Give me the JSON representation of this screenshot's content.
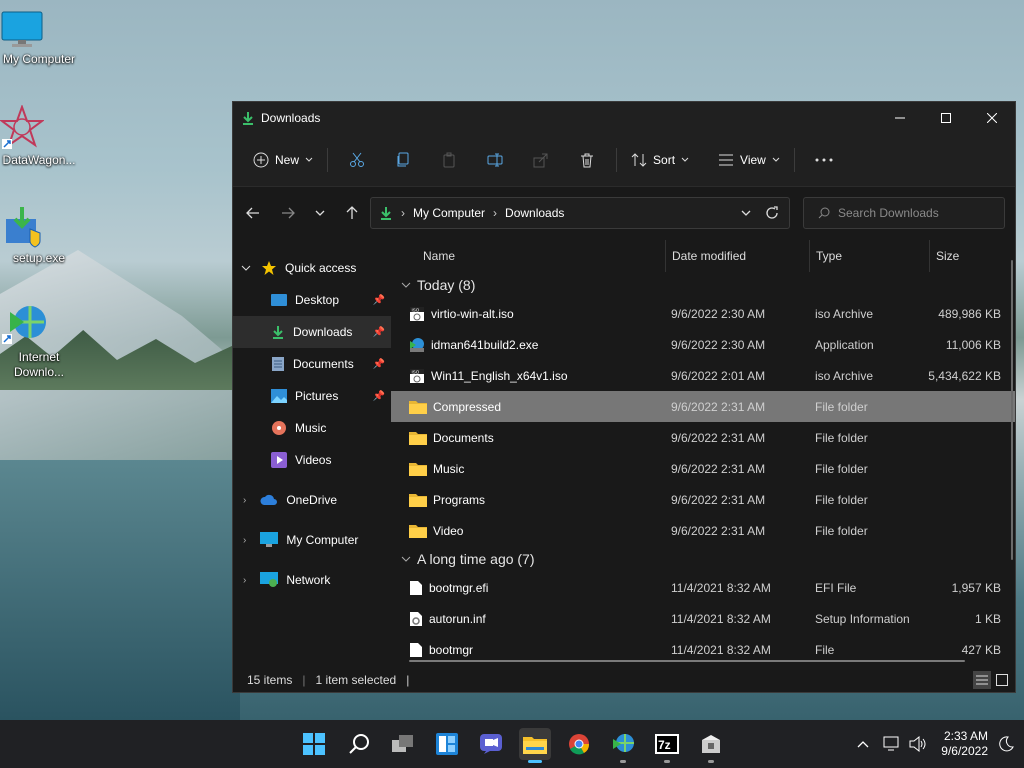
{
  "desktop": {
    "icons": [
      {
        "label": "My Computer"
      },
      {
        "label": "DataWagon..."
      },
      {
        "label": "setup.exe"
      },
      {
        "label": "Internet Downlo..."
      }
    ]
  },
  "window": {
    "title": "Downloads",
    "toolbar": {
      "new_label": "New",
      "sort_label": "Sort",
      "view_label": "View"
    },
    "address": {
      "crumbs": [
        "My Computer",
        "Downloads"
      ]
    },
    "search": {
      "placeholder": "Search Downloads"
    },
    "sidebar": {
      "quick_access": "Quick access",
      "items": [
        {
          "label": "Desktop"
        },
        {
          "label": "Downloads"
        },
        {
          "label": "Documents"
        },
        {
          "label": "Pictures"
        },
        {
          "label": "Music"
        },
        {
          "label": "Videos"
        }
      ],
      "onedrive": "OneDrive",
      "my_computer": "My Computer",
      "network": "Network"
    },
    "columns": {
      "name": "Name",
      "date": "Date modified",
      "type": "Type",
      "size": "Size"
    },
    "groups": [
      {
        "label": "Today (8)",
        "files": [
          {
            "name": "virtio-win-alt.iso",
            "date": "9/6/2022 2:30 AM",
            "type": "iso Archive",
            "size": "489,986 KB",
            "icon": "iso-icon"
          },
          {
            "name": "idman641build2.exe",
            "date": "9/6/2022 2:30 AM",
            "type": "Application",
            "size": "11,006 KB",
            "icon": "exe-icon"
          },
          {
            "name": "Win11_English_x64v1.iso",
            "date": "9/6/2022 2:01 AM",
            "type": "iso Archive",
            "size": "5,434,622 KB",
            "icon": "iso-icon"
          },
          {
            "name": "Compressed",
            "date": "9/6/2022 2:31 AM",
            "type": "File folder",
            "size": "",
            "icon": "folder-icon"
          },
          {
            "name": "Documents",
            "date": "9/6/2022 2:31 AM",
            "type": "File folder",
            "size": "",
            "icon": "folder-icon"
          },
          {
            "name": "Music",
            "date": "9/6/2022 2:31 AM",
            "type": "File folder",
            "size": "",
            "icon": "folder-icon"
          },
          {
            "name": "Programs",
            "date": "9/6/2022 2:31 AM",
            "type": "File folder",
            "size": "",
            "icon": "folder-icon"
          },
          {
            "name": "Video",
            "date": "9/6/2022 2:31 AM",
            "type": "File folder",
            "size": "",
            "icon": "folder-icon"
          }
        ]
      },
      {
        "label": "A long time ago (7)",
        "files": [
          {
            "name": "bootmgr.efi",
            "date": "11/4/2021 8:32 AM",
            "type": "EFI File",
            "size": "1,957 KB",
            "icon": "file-icon"
          },
          {
            "name": "autorun.inf",
            "date": "11/4/2021 8:32 AM",
            "type": "Setup Information",
            "size": "1 KB",
            "icon": "settings-file-icon"
          },
          {
            "name": "bootmgr",
            "date": "11/4/2021 8:32 AM",
            "type": "File",
            "size": "427 KB",
            "icon": "file-icon"
          }
        ]
      }
    ],
    "status": {
      "count": "15 items",
      "selected": "1 item selected"
    }
  },
  "taskbar": {
    "clock_time": "2:33 AM",
    "clock_date": "9/6/2022",
    "icons": [
      "start-icon",
      "search-icon",
      "task-view-icon",
      "widgets-icon",
      "chat-icon",
      "file-explorer-icon",
      "chrome-icon",
      "idm-icon",
      "7zip-icon",
      "app-icon"
    ]
  }
}
